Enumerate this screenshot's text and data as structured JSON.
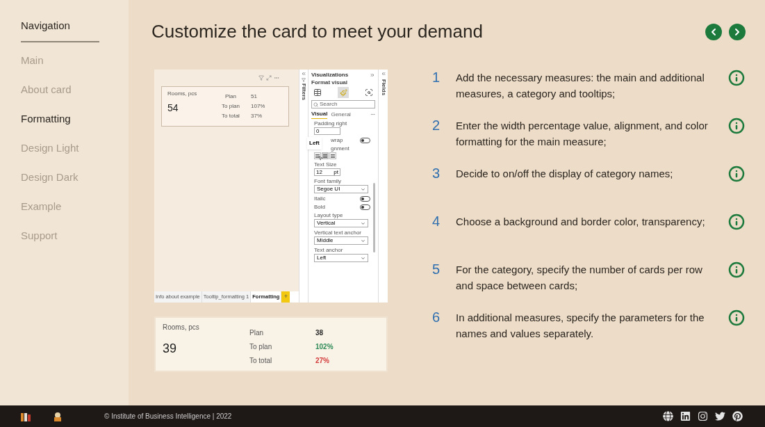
{
  "sidebar": {
    "title": "Navigation",
    "items": [
      {
        "label": "Main",
        "selected": false
      },
      {
        "label": "About card",
        "selected": false
      },
      {
        "label": "Formatting",
        "selected": true
      },
      {
        "label": "Design Light",
        "selected": false
      },
      {
        "label": "Design Dark",
        "selected": false
      },
      {
        "label": "Example",
        "selected": false
      },
      {
        "label": "Support",
        "selected": false
      }
    ]
  },
  "title": "Customize the card to meet your demand",
  "nav_buttons": [
    {
      "kind": "prev"
    },
    {
      "kind": "next"
    }
  ],
  "screen": {
    "card": {
      "title": "Rooms, pcs",
      "value": "54",
      "rows": [
        {
          "label": "Plan",
          "value": "51"
        },
        {
          "label": "To plan",
          "value": "107%"
        },
        {
          "label": "To total",
          "value": "37%"
        }
      ]
    },
    "filters_label": "Filters",
    "pane": {
      "title": "Visualizations",
      "subtitle": "Format visual",
      "search_placeholder": "Search",
      "tabs": [
        {
          "label": "Visual",
          "selected": true
        },
        {
          "label": "General",
          "selected": false
        }
      ],
      "settings": [
        {
          "kind": "number",
          "label": "Padding right",
          "value": "0"
        },
        {
          "kind": "toggle",
          "label": "wrap",
          "on": false
        },
        {
          "kind": "align",
          "label": "gnment",
          "tooltip": "Left",
          "buttons": [
            {
              "selected": false
            },
            {
              "selected": true
            },
            {
              "selected": false
            }
          ]
        },
        {
          "kind": "number",
          "label": "Text Size",
          "value": "12",
          "unit": "pt"
        },
        {
          "kind": "select",
          "label": "Font family",
          "value": "Segoe UI"
        },
        {
          "kind": "toggle",
          "label": "Italic",
          "on": false
        },
        {
          "kind": "toggle",
          "label": "Bold",
          "on": false
        },
        {
          "kind": "select",
          "label": "Layout type",
          "value": "Vertical"
        },
        {
          "kind": "select",
          "label": "Vertical text anchor",
          "value": "Middle"
        },
        {
          "kind": "select",
          "label": "Text anchor",
          "value": "Left"
        }
      ]
    },
    "fields_label": "Fields",
    "page_tabs": [
      {
        "label": "Info about example",
        "selected": false
      },
      {
        "label": "Tooltip_formatting 1",
        "selected": false
      },
      {
        "label": "Formatting",
        "selected": true
      }
    ],
    "add_page": "+"
  },
  "card": {
    "title": "Rooms, pcs",
    "value": "39",
    "rows": [
      {
        "label": "Plan",
        "value": "38",
        "color": "#2b2b2b"
      },
      {
        "label": "To plan",
        "value": "102%",
        "color": "#2e8b57"
      },
      {
        "label": "To total",
        "value": "27%",
        "color": "#d33a3a"
      }
    ]
  },
  "steps": [
    {
      "number": "1",
      "text": "Add the necessary measures: the main and additional measures, a category and tooltips;"
    },
    {
      "number": "2",
      "text": "Enter the width percentage value, alignment, and color formatting for the main measure;"
    },
    {
      "number": "3",
      "text": "Decide to on/off the display of category names;"
    },
    {
      "number": "4",
      "text": "Choose a background and border color, transparency;"
    },
    {
      "number": "5",
      "text": "For the category, specify the number of cards per row and space between cards;"
    },
    {
      "number": "6",
      "text": "In additional measures, specify the parameters for the names and values separately."
    }
  ],
  "footer": {
    "copyright": "© Institute of Business Intelligence | 2022"
  }
}
